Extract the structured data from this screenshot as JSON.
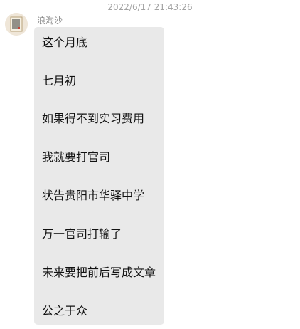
{
  "timestamp": "2022/6/17 21:43:26",
  "sender": {
    "name": "浪淘沙",
    "avatar": "profile-avatar"
  },
  "message": {
    "lines": [
      "这个月底",
      "七月初",
      "如果得不到实习费用",
      "我就要打官司",
      "状告贵阳市华驿中学",
      "万一官司打输了",
      "未来要把前后写成文章",
      "公之于众"
    ],
    "bubble_color": "#e9e9e9"
  }
}
